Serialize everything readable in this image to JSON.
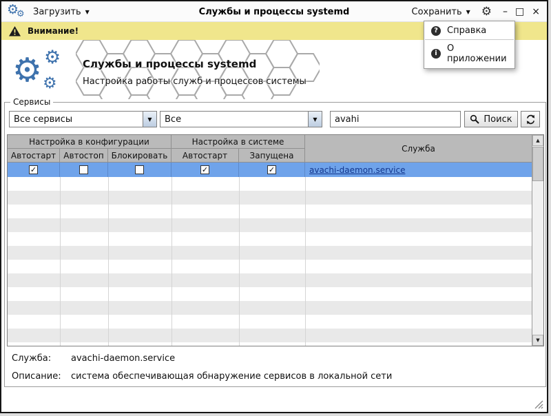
{
  "icons": {
    "gear": "⚙",
    "chevron_down": "▼",
    "check": "✓",
    "scroll_up": "▲",
    "scroll_down": "▼",
    "minimize": "–",
    "restore": "□",
    "close": "×",
    "help_glyph": "?",
    "about_glyph": "i"
  },
  "titlebar": {
    "load": "Загрузить",
    "title": "Службы и процессы systemd",
    "save": "Сохранить"
  },
  "warning": {
    "label": "Внимание!"
  },
  "menu": {
    "help": "Справка",
    "about": "О приложении"
  },
  "banner": {
    "title": "Службы и процессы systemd",
    "subtitle": "Настройка работы служб и процессов системы"
  },
  "filters": {
    "legend": "Сервисы",
    "service_filter": "Все сервисы",
    "state_filter": "Все",
    "search_value": "avahi",
    "search_label": "Поиск"
  },
  "table": {
    "group_config": "Настройка в конфигурации",
    "group_system": "Настройка в системе",
    "col_service": "Служба",
    "col_autostart_config": "Автостарт",
    "col_autostop": "Автостоп",
    "col_block": "Блокировать",
    "col_autostart_system": "Автостарт",
    "col_running": "Запущена",
    "rows": [
      {
        "autostart_config": true,
        "autostop": false,
        "block": false,
        "autostart_system": true,
        "running": true,
        "service": "avachi-daemon.service",
        "selected": true
      }
    ]
  },
  "details": {
    "service_label": "Служба:",
    "service_value": "avachi-daemon.service",
    "description_label": "Описание:",
    "description_value": "система обеспечивающая обнаружение сервисов в локальной сети"
  },
  "colors": {
    "accent": "#3e72ad",
    "selection": "#6fa3ea",
    "warning_bg": "#f0e68c",
    "link": "#12358c",
    "header_gray": "#bababa"
  }
}
